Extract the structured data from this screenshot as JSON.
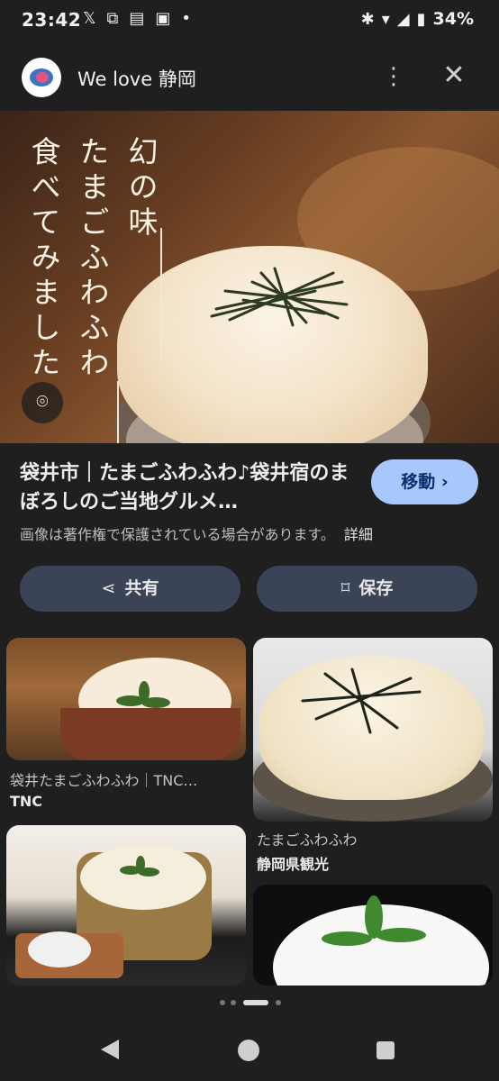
{
  "status_bar": {
    "time": "23:42",
    "icons": [
      "x-logo-icon",
      "copy-icon",
      "news-icon",
      "au-icon",
      "dot-icon"
    ],
    "battery": "34%"
  },
  "header": {
    "site_name": "We love 静岡"
  },
  "hero": {
    "overlay_text": [
      "幻の味",
      "たまごふわふわ",
      "食べてみました"
    ]
  },
  "result": {
    "title": "袋井市｜たまごふわふわ♪袋井宿のまぼろしのご当地グルメ…",
    "visit_label": "移動",
    "copyright_notice": "画像は著作権で保護されている場合があります。",
    "details_label": "詳細"
  },
  "actions": {
    "share_label": "共有",
    "save_label": "保存"
  },
  "related": [
    {
      "caption": "袋井たまごふわふわ｜TNC…",
      "source": "TNC"
    },
    {
      "caption": "たまごふわふわ",
      "source": "静岡県観光"
    },
    {
      "caption": "",
      "source": ""
    },
    {
      "caption": "",
      "source": ""
    }
  ]
}
